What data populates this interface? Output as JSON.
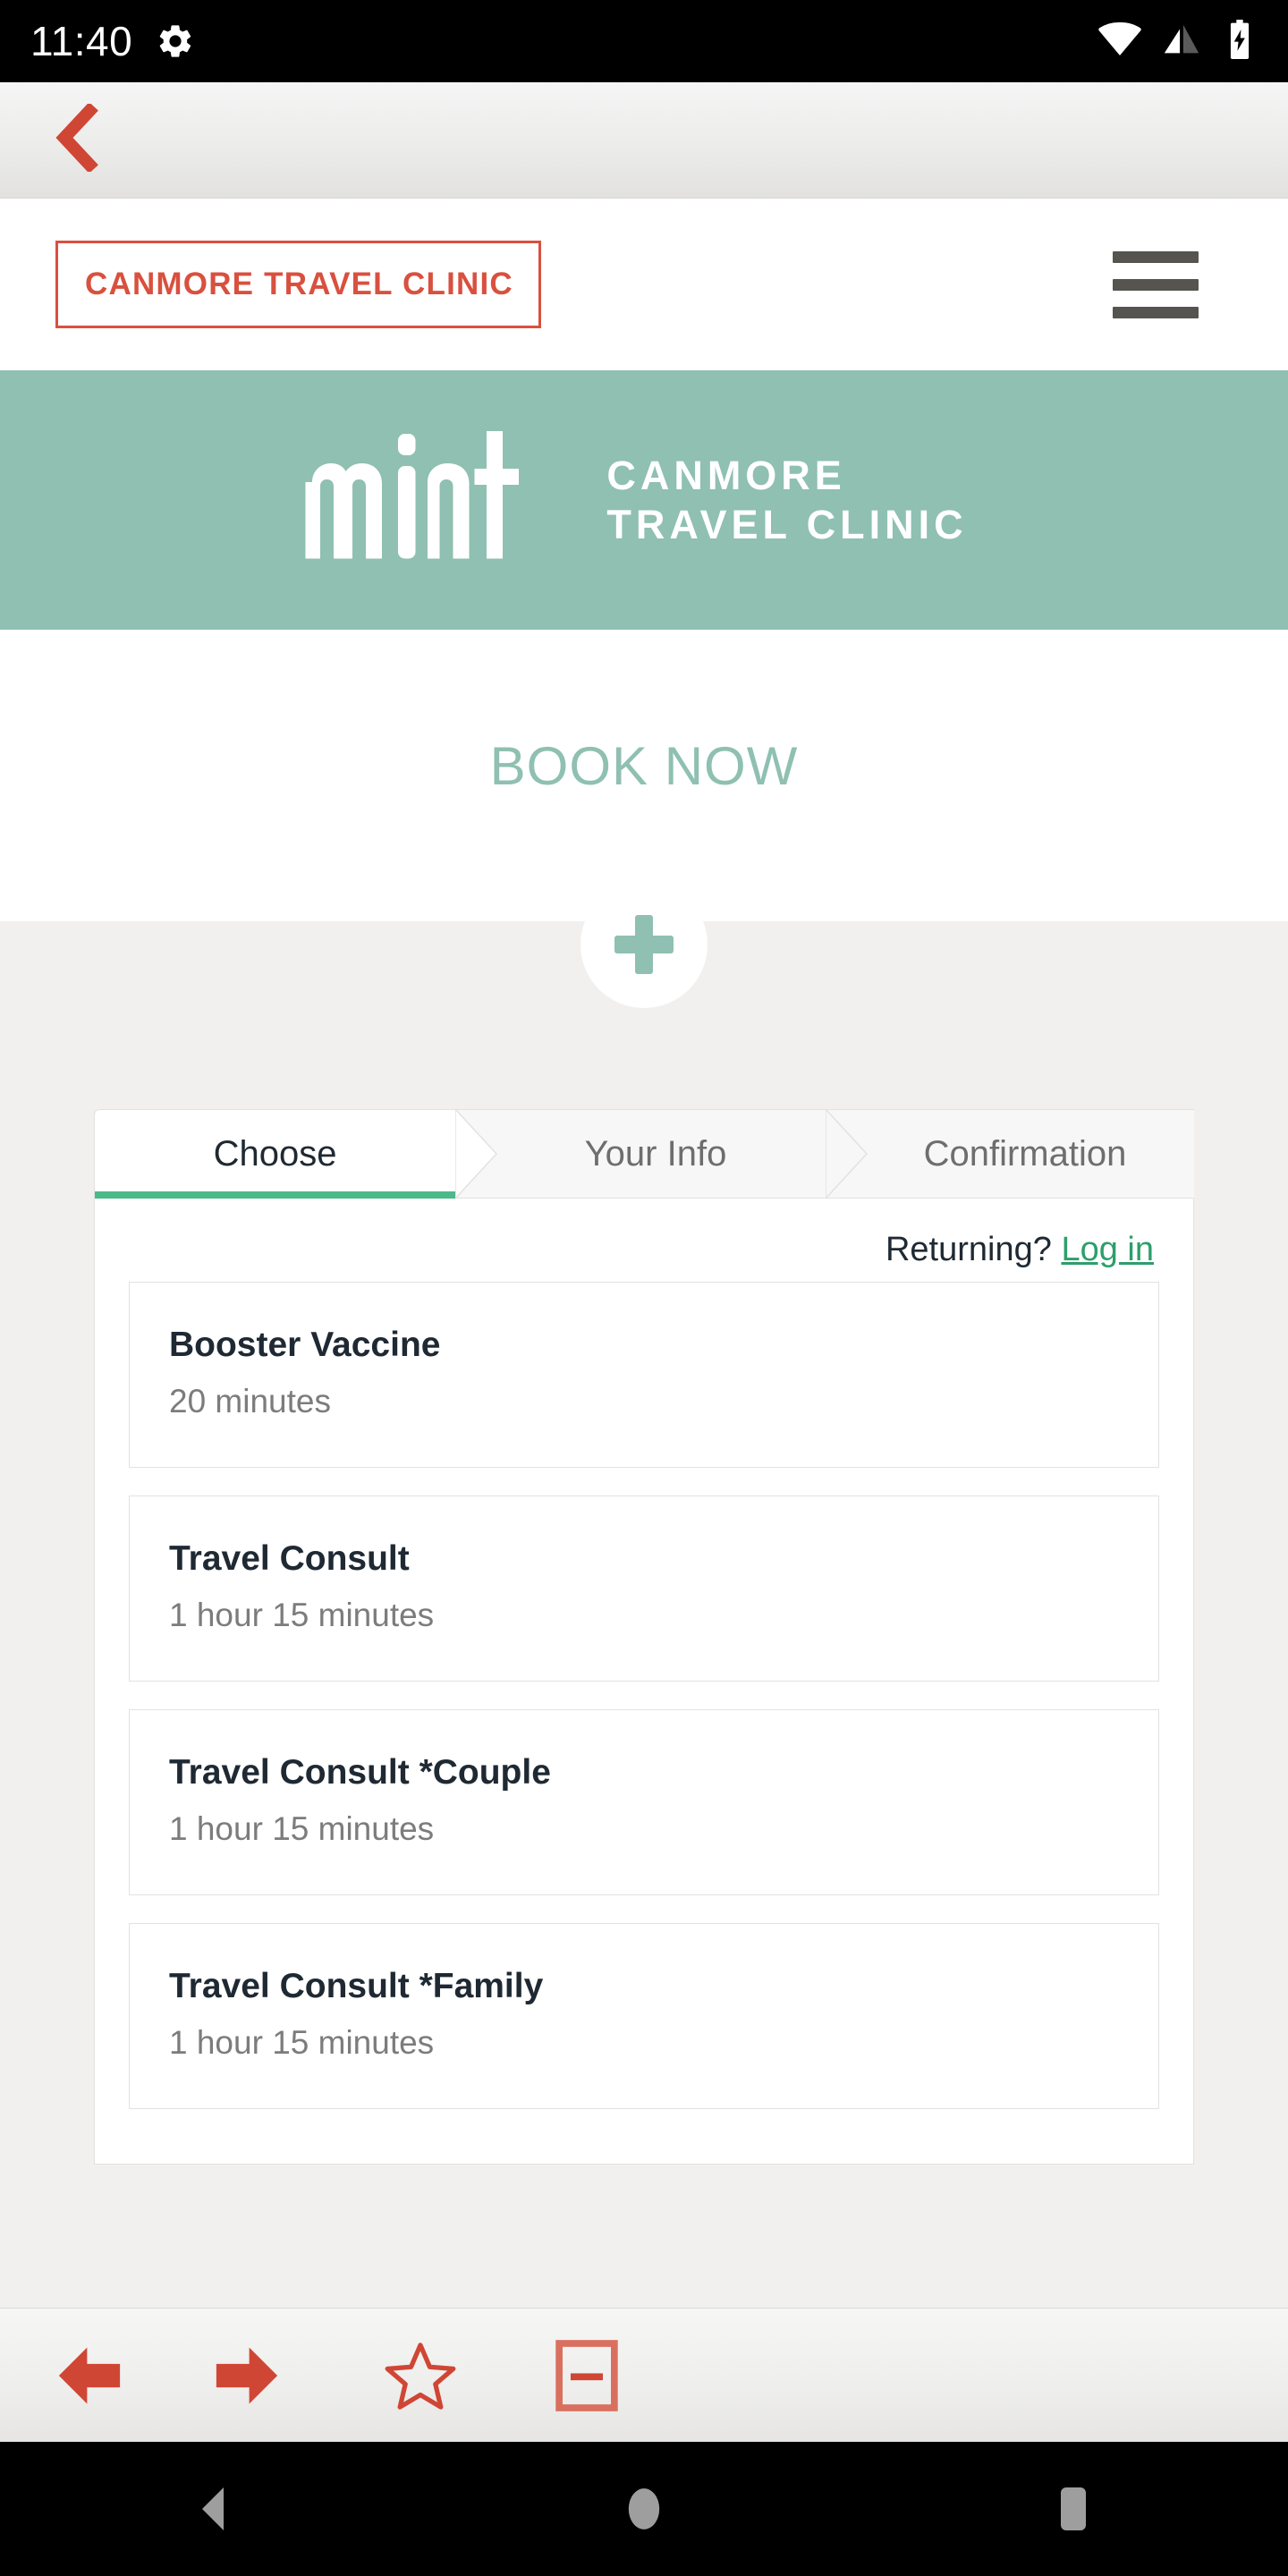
{
  "status_bar": {
    "time": "11:40",
    "icons": [
      "gear-icon",
      "wifi-icon",
      "cellular-signal-icon",
      "battery-charging-icon"
    ]
  },
  "browser": {
    "back_icon": "chevron-left-icon",
    "accent_color": "#d9503f",
    "bottom_toolbar": [
      {
        "name": "back-arrow-icon",
        "label": "Back"
      },
      {
        "name": "forward-arrow-icon",
        "label": "Forward"
      },
      {
        "name": "star-outline-icon",
        "label": "Bookmark"
      },
      {
        "name": "tabs-icon",
        "label": "Tabs"
      }
    ]
  },
  "site_header": {
    "brand": "CANMORE TRAVEL CLINIC",
    "menu_icon": "hamburger-menu-icon"
  },
  "banner": {
    "logo_word": "mint",
    "line1": "CANMORE",
    "line2": "TRAVEL CLINIC",
    "background_color": "#8fc0b1"
  },
  "book_now": {
    "heading": "BOOK NOW",
    "expand_icon": "plus-icon",
    "accent_color": "#8fc0b1"
  },
  "booking_widget": {
    "tabs": [
      {
        "label": "Choose",
        "active": true
      },
      {
        "label": "Your Info",
        "active": false
      },
      {
        "label": "Confirmation",
        "active": false
      }
    ],
    "active_tab_underline_color": "#4cb98a",
    "returning_prompt": "Returning?",
    "login_link": "Log in",
    "services": [
      {
        "name": "Booster Vaccine",
        "duration": "20 minutes"
      },
      {
        "name": "Travel Consult",
        "duration": "1 hour 15 minutes"
      },
      {
        "name": "Travel Consult *Couple",
        "duration": "1 hour 15 minutes"
      },
      {
        "name": "Travel Consult *Family",
        "duration": "1 hour 15 minutes"
      }
    ]
  },
  "android_nav": {
    "buttons": [
      {
        "name": "nav-back-icon",
        "label": "Back"
      },
      {
        "name": "nav-home-icon",
        "label": "Home"
      },
      {
        "name": "nav-recents-icon",
        "label": "Recents"
      }
    ]
  }
}
